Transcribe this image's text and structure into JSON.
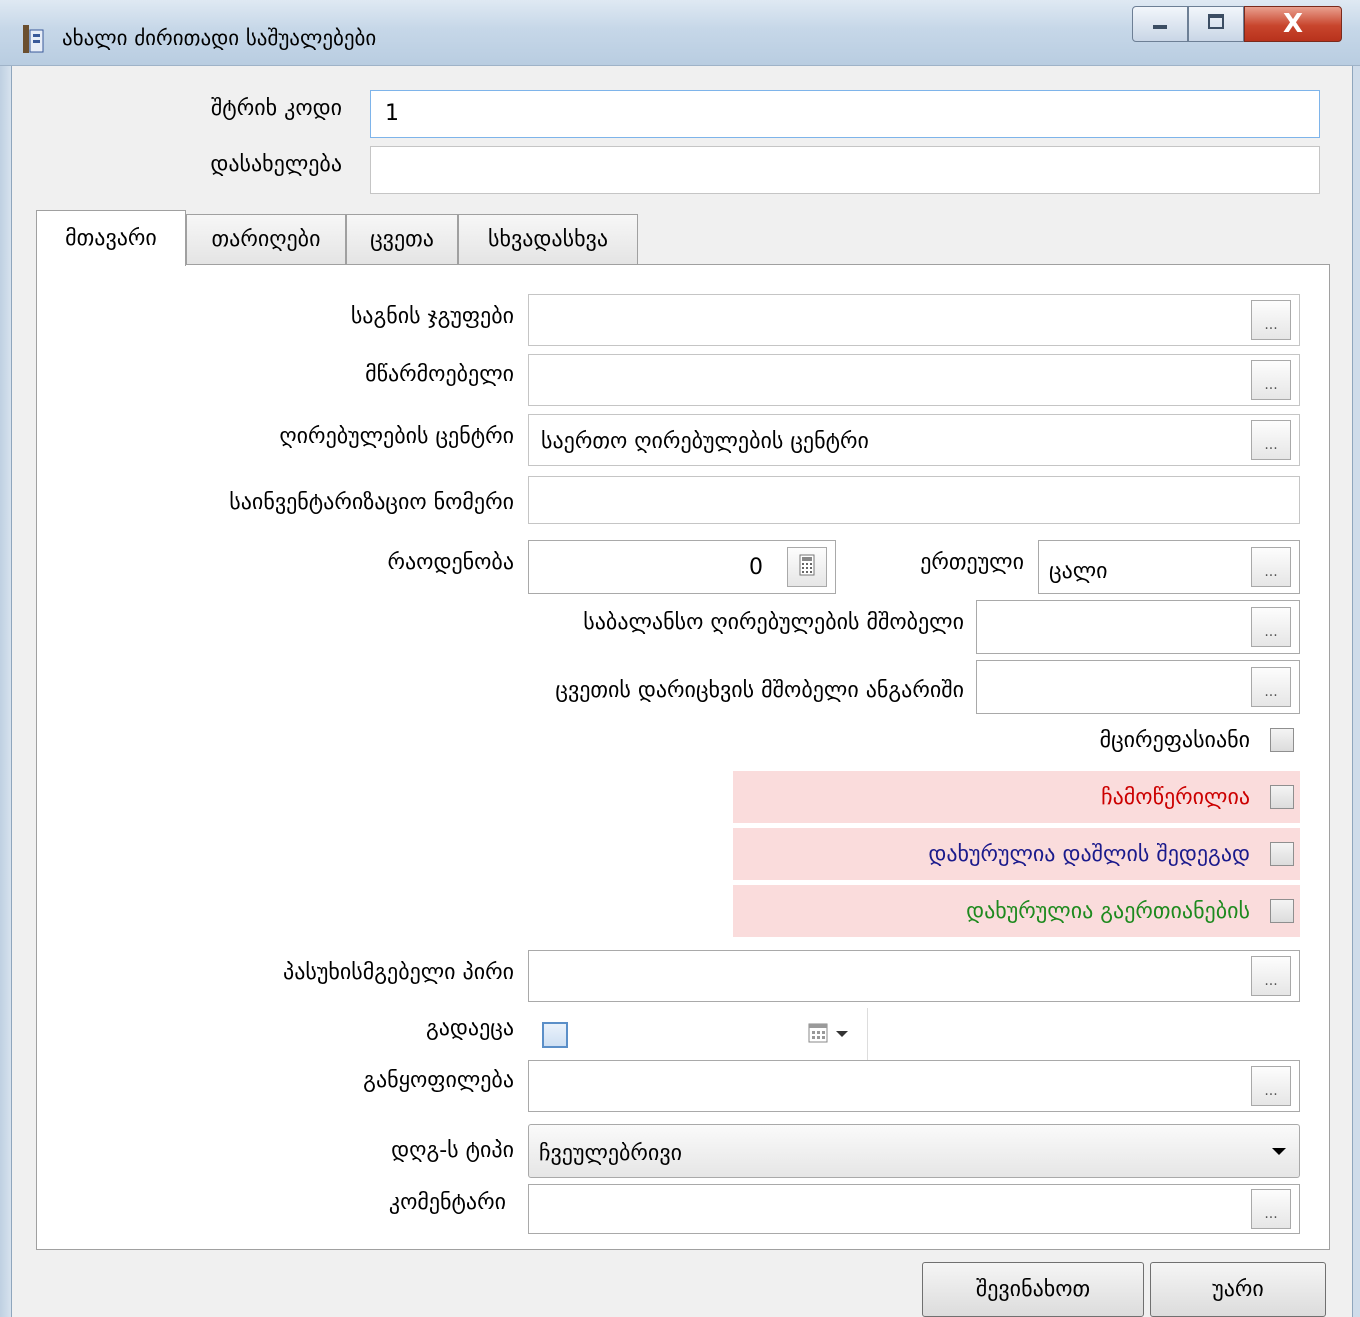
{
  "window": {
    "title": "ახალი ძირითადი საშუალებები",
    "close_glyph": "X"
  },
  "header": {
    "barcode_label": "შტრიხ კოდი",
    "barcode_value": "1",
    "name_label": "დასახელება",
    "name_value": ""
  },
  "tabs": [
    {
      "label": "მთავარი"
    },
    {
      "label": "თარიღები"
    },
    {
      "label": "ცვეთა"
    },
    {
      "label": "სხვადასხვა"
    }
  ],
  "main": {
    "groups_label": "საგნის ჯგუფები",
    "manufacturer_label": "მწარმოებელი",
    "value_center_label": "ღირებულების ცენტრი",
    "value_center_value": "საერთო ღირებულების ცენტრი",
    "inventory_label": "საინვენტარიზაციო ნომერი",
    "quantity_label": "რაოდენობა",
    "quantity_value": "0",
    "unit_label": "ერთეული",
    "unit_value": "ცალი",
    "balance_parent_label": "საბალანსო ღირებულების მშობელი",
    "depreciation_parent_label": "ცვეთის დარიცხვის მშობელი ანგარიში",
    "low_value_label": "მცირეფასიანი",
    "written_off_label": "ჩამოწერილია",
    "closed_damage_label": "დახურულია დაშლის შედეგად",
    "closed_merge_label": "დახურულია გაერთიანების",
    "responsible_label": "პასუხისმგებელი პირი",
    "handover_label": "გადაეცა",
    "department_label": "განყოფილება",
    "vat_type_label": "დღგ-ს ტიპი",
    "vat_type_value": "ჩვეულებრივი",
    "comment_label": "კომენტარი",
    "ellipsis": "..."
  },
  "footer": {
    "save_label": "შევინახოთ",
    "cancel_label": "უარი"
  },
  "colors": {
    "written_off": "#cc0000",
    "closed_damage": "#1a1a8c",
    "closed_merge": "#1e8a1e",
    "pink_band": "#fadcdc"
  },
  "icons": [
    "app-icon",
    "minimize-icon",
    "maximize-icon",
    "close-icon",
    "calculator-icon",
    "calendar-icon",
    "dropdown-arrow-icon"
  ]
}
